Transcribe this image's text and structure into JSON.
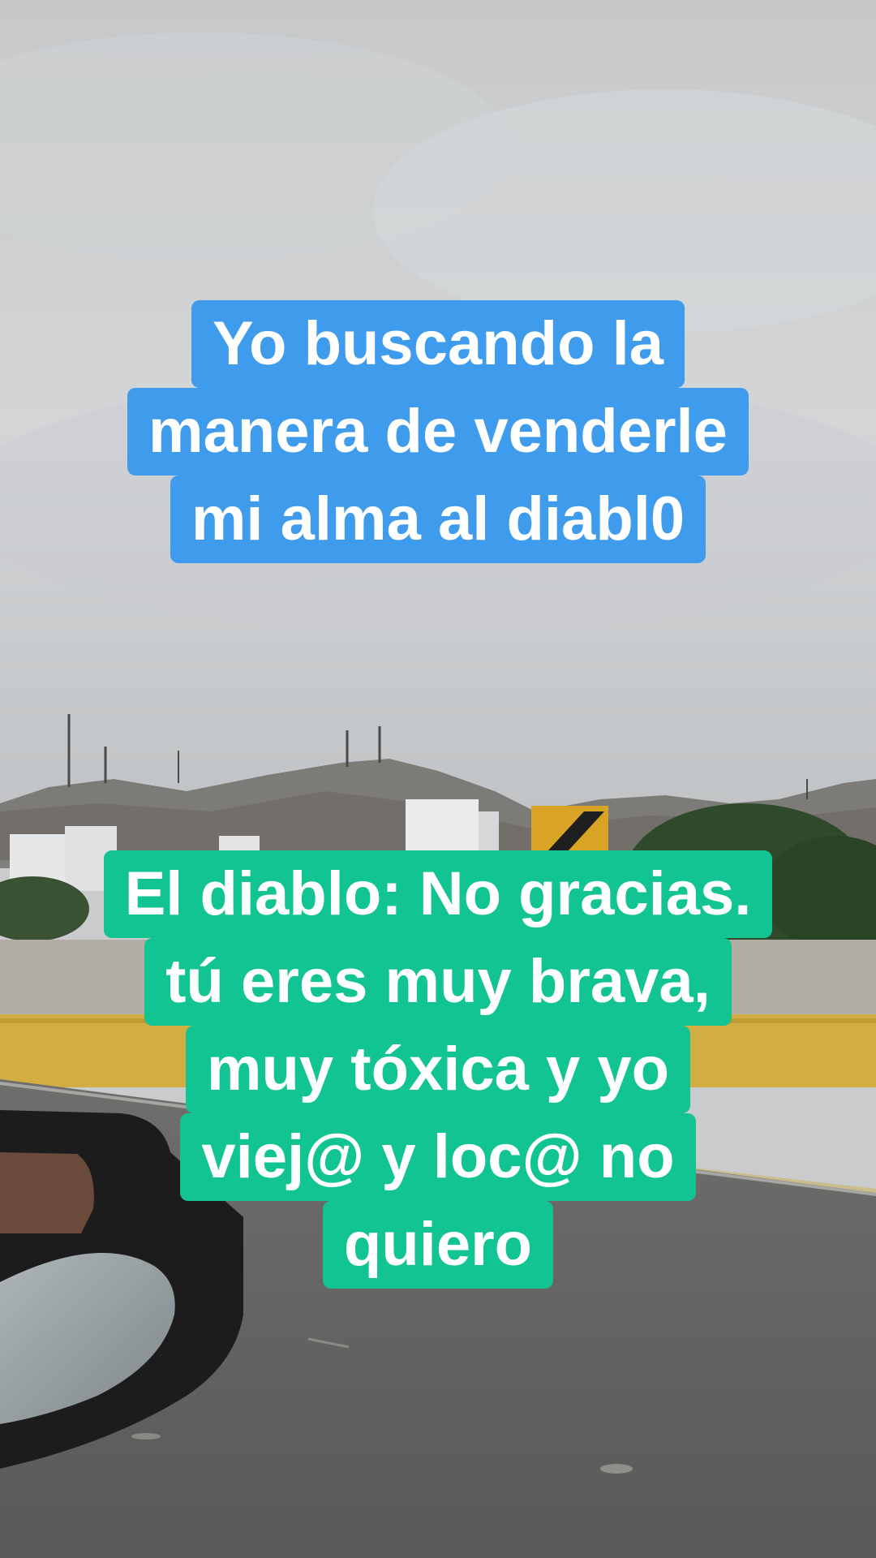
{
  "video": {
    "scene_description_icon": "cloudy-highway-scene"
  },
  "captions": {
    "top": {
      "color": "#3f9bec",
      "lines": [
        "Yo buscando la",
        "manera de venderle",
        "mi alma al diabl0"
      ]
    },
    "bottom": {
      "color": "#12c491",
      "lines": [
        "El diablo: No gracias.",
        "tú eres muy brava,",
        "muy tóxica y yo",
        "viej@ y loc@ no",
        "quiero"
      ]
    }
  }
}
